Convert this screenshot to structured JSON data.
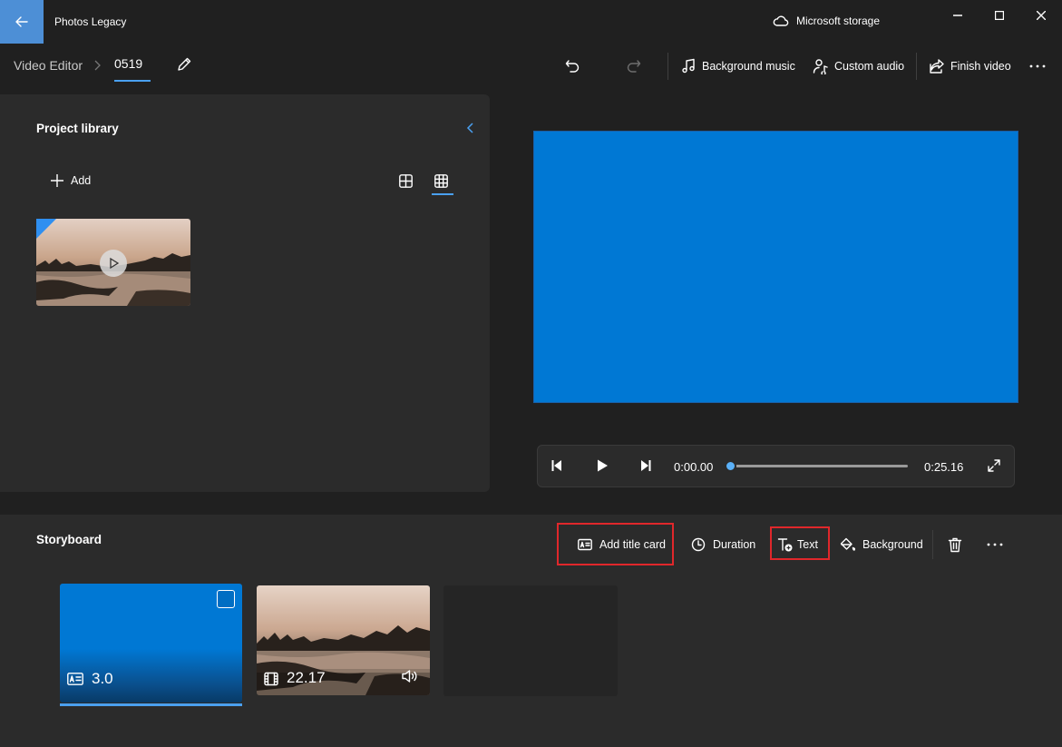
{
  "window": {
    "app_title": "Photos Legacy",
    "storage_label": "Microsoft storage"
  },
  "toolbar": {
    "breadcrumb_root": "Video Editor",
    "project_name": "0519",
    "background_music": "Background music",
    "custom_audio": "Custom audio",
    "finish_video": "Finish video"
  },
  "library": {
    "title": "Project library",
    "add_label": "Add"
  },
  "player": {
    "current_time": "0:00.00",
    "total_time": "0:25.16",
    "progress": 0
  },
  "storyboard": {
    "title": "Storyboard",
    "add_title_card": "Add title card",
    "duration": "Duration",
    "text": "Text",
    "background": "Background",
    "clips": [
      {
        "type": "title-card",
        "duration": "3.0",
        "selected": true
      },
      {
        "type": "video",
        "duration": "22.17",
        "has_audio": true
      },
      {
        "type": "empty"
      }
    ]
  },
  "colors": {
    "accent": "#0078d4",
    "highlight_box": "#e0272b",
    "title_bar_back": "#4d8fd6"
  }
}
